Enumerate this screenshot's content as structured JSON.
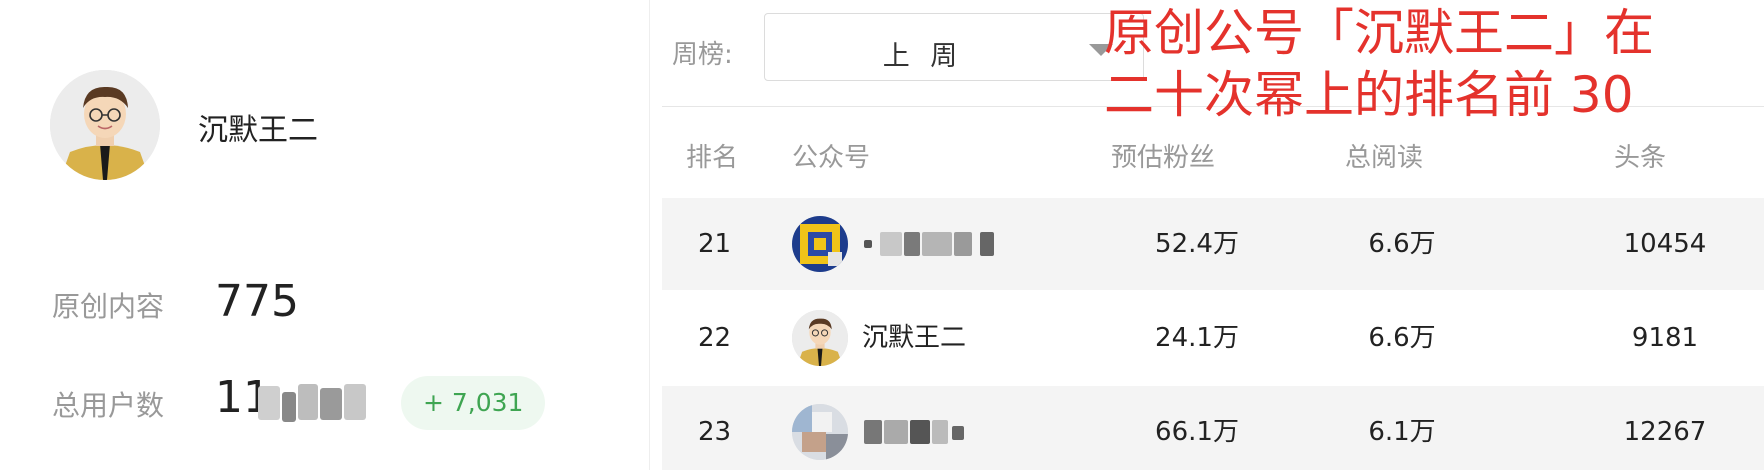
{
  "profile": {
    "name": "沉默王二",
    "original_label": "原创内容",
    "original_value": "775",
    "users_label": "总用户数",
    "users_value_prefix": "11",
    "users_growth": "+ 7,031"
  },
  "filter": {
    "label": "周榜:",
    "selected": "上 周"
  },
  "table": {
    "headers": [
      "排名",
      "公众号",
      "预估粉丝",
      "总阅读",
      "头条"
    ],
    "rows": [
      {
        "rank": "21",
        "name": "",
        "fans": "52.4万",
        "reads": "6.6万",
        "headline": "10454"
      },
      {
        "rank": "22",
        "name": "沉默王二",
        "fans": "24.1万",
        "reads": "6.6万",
        "headline": "9181"
      },
      {
        "rank": "23",
        "name": "",
        "fans": "66.1万",
        "reads": "6.1万",
        "headline": "12267"
      }
    ]
  },
  "annotation": {
    "line1": "原创公号「沉默王二」在",
    "line2": "二十次幂上的排名前 30"
  },
  "colors": {
    "annotation": "#e4322c",
    "growth": "#3fa552",
    "muted": "#999999"
  }
}
